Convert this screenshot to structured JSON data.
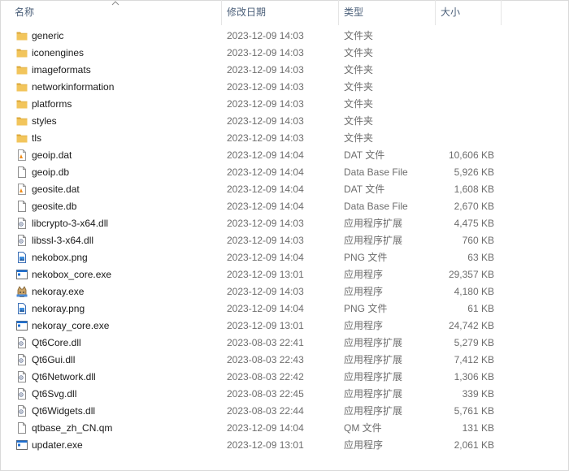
{
  "columns": {
    "name": "名称",
    "date": "修改日期",
    "type": "类型",
    "size": "大小"
  },
  "files": [
    {
      "name": "generic",
      "date": "2023-12-09  14:03",
      "type": "文件夹",
      "size": "",
      "icon": "folder-icon"
    },
    {
      "name": "iconengines",
      "date": "2023-12-09  14:03",
      "type": "文件夹",
      "size": "",
      "icon": "folder-icon"
    },
    {
      "name": "imageformats",
      "date": "2023-12-09  14:03",
      "type": "文件夹",
      "size": "",
      "icon": "folder-icon"
    },
    {
      "name": "networkinformation",
      "date": "2023-12-09  14:03",
      "type": "文件夹",
      "size": "",
      "icon": "folder-icon"
    },
    {
      "name": "platforms",
      "date": "2023-12-09  14:03",
      "type": "文件夹",
      "size": "",
      "icon": "folder-icon"
    },
    {
      "name": "styles",
      "date": "2023-12-09  14:03",
      "type": "文件夹",
      "size": "",
      "icon": "folder-icon"
    },
    {
      "name": "tls",
      "date": "2023-12-09  14:03",
      "type": "文件夹",
      "size": "",
      "icon": "folder-icon"
    },
    {
      "name": "geoip.dat",
      "date": "2023-12-09  14:04",
      "type": "DAT 文件",
      "size": "10,606 KB",
      "icon": "vlc-file-icon"
    },
    {
      "name": "geoip.db",
      "date": "2023-12-09  14:04",
      "type": "Data Base File",
      "size": "5,926 KB",
      "icon": "file-icon"
    },
    {
      "name": "geosite.dat",
      "date": "2023-12-09  14:04",
      "type": "DAT 文件",
      "size": "1,608 KB",
      "icon": "vlc-file-icon"
    },
    {
      "name": "geosite.db",
      "date": "2023-12-09  14:04",
      "type": "Data Base File",
      "size": "2,670 KB",
      "icon": "file-icon"
    },
    {
      "name": "libcrypto-3-x64.dll",
      "date": "2023-12-09  14:03",
      "type": "应用程序扩展",
      "size": "4,475 KB",
      "icon": "dll-icon"
    },
    {
      "name": "libssl-3-x64.dll",
      "date": "2023-12-09  14:03",
      "type": "应用程序扩展",
      "size": "760 KB",
      "icon": "dll-icon"
    },
    {
      "name": "nekobox.png",
      "date": "2023-12-09  14:04",
      "type": "PNG 文件",
      "size": "63 KB",
      "icon": "png-icon"
    },
    {
      "name": "nekobox_core.exe",
      "date": "2023-12-09  13:01",
      "type": "应用程序",
      "size": "29,357 KB",
      "icon": "exe-icon"
    },
    {
      "name": "nekoray.exe",
      "date": "2023-12-09  14:03",
      "type": "应用程序",
      "size": "4,180 KB",
      "icon": "nekoray-app-icon"
    },
    {
      "name": "nekoray.png",
      "date": "2023-12-09  14:04",
      "type": "PNG 文件",
      "size": "61 KB",
      "icon": "png-icon"
    },
    {
      "name": "nekoray_core.exe",
      "date": "2023-12-09  13:01",
      "type": "应用程序",
      "size": "24,742 KB",
      "icon": "exe-icon"
    },
    {
      "name": "Qt6Core.dll",
      "date": "2023-08-03  22:41",
      "type": "应用程序扩展",
      "size": "5,279 KB",
      "icon": "dll-icon"
    },
    {
      "name": "Qt6Gui.dll",
      "date": "2023-08-03  22:43",
      "type": "应用程序扩展",
      "size": "7,412 KB",
      "icon": "dll-icon"
    },
    {
      "name": "Qt6Network.dll",
      "date": "2023-08-03  22:42",
      "type": "应用程序扩展",
      "size": "1,306 KB",
      "icon": "dll-icon"
    },
    {
      "name": "Qt6Svg.dll",
      "date": "2023-08-03  22:45",
      "type": "应用程序扩展",
      "size": "339 KB",
      "icon": "dll-icon"
    },
    {
      "name": "Qt6Widgets.dll",
      "date": "2023-08-03  22:44",
      "type": "应用程序扩展",
      "size": "5,761 KB",
      "icon": "dll-icon"
    },
    {
      "name": "qtbase_zh_CN.qm",
      "date": "2023-12-09  14:04",
      "type": "QM 文件",
      "size": "131 KB",
      "icon": "file-icon"
    },
    {
      "name": "updater.exe",
      "date": "2023-12-09  13:01",
      "type": "应用程序",
      "size": "2,061 KB",
      "icon": "exe-icon"
    }
  ],
  "colors": {
    "header_text": "#4c607a",
    "folder": "#f2c55c",
    "folder_dark": "#dba737",
    "exe_blue": "#1f6fd0",
    "muted_text": "#6d6d6d"
  }
}
